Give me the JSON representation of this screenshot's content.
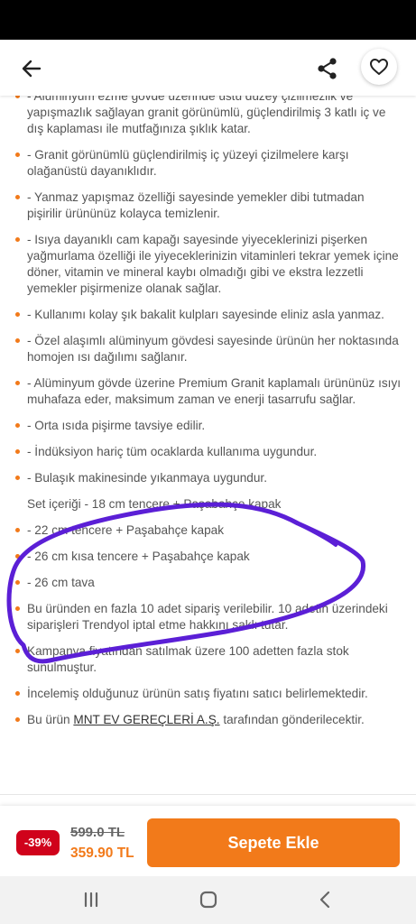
{
  "header": {
    "back_icon": "arrow-left-icon",
    "share_icon": "share-icon",
    "favorite_icon": "heart-outline-icon"
  },
  "description": {
    "items": [
      "- Alüminyum ezme gövde üzerinde üstü düzey çizilmezlik ve yapışmazlık sağlayan granit görünümlü, güçlendirilmiş 3 katlı iç ve dış kaplaması ile mutfağınıza şıklık katar.",
      "- Granit görünümlü güçlendirilmiş iç yüzeyi çizilmelere karşı olağanüstü dayanıklıdır.",
      "- Yanmaz yapışmaz özelliği sayesinde yemekler dibi tutmadan pişirilir ürününüz kolayca temizlenir.",
      "- Isıya dayanıklı cam kapağı sayesinde yiyeceklerinizi pişerken yağmurlama özelliği ile yiyeceklerinizin vitaminleri tekrar yemek içine döner, vitamin ve mineral kaybı olmadığı gibi ve ekstra lezzetli yemekler pişirmenize olanak sağlar.",
      "- Kullanımı kolay şık bakalit kulpları sayesinde eliniz asla yanmaz.",
      "- Özel alaşımlı alüminyum gövdesi sayesinde ürünün her noktasında homojen ısı dağılımı sağlanır.",
      "- Alüminyum gövde üzerine Premium Granit kaplamalı ürününüz ısıyı muhafaza eder, maksimum zaman ve enerji tasarrufu sağlar.",
      "- Orta ısıda pişirme tavsiye edilir.",
      "- İndüksiyon hariç tüm ocaklarda kullanıma uygundur.",
      "- Bulaşık makinesinde yıkanmaya uygundur.",
      "Set içeriği - 18 cm tencere + Paşabahçe kapak",
      "- 22 cm tencere + Paşabahçe kapak",
      "- 26 cm kısa tencere + Paşabahçe kapak",
      "- 26 cm tava"
    ],
    "notes": [
      "Bu üründen en fazla 10 adet sipariş verilebilir. 10 adetin üzerindeki siparişleri Trendyol iptal etme hakkını saklı tutar.",
      "Kampanya fiyatından satılmak üzere 100 adetten fazla stok sunulmuştur.",
      "İncelemiş olduğunuz ürünün satış fiyatını satıcı belirlemektedir."
    ],
    "seller_prefix": "Bu ürün ",
    "seller_name": "MNT EV GEREÇLERİ A.Ş.",
    "seller_suffix": " tarafından gönderilecektir."
  },
  "purchase": {
    "discount": "-39%",
    "old_price": "599.0 TL",
    "new_price": "359.90 TL",
    "add_to_cart": "Sepete Ekle"
  },
  "colors": {
    "accent": "#f27a1a",
    "discount": "#d0021b",
    "annotation": "#5b1fd6"
  },
  "system_nav": [
    "recents-icon",
    "home-icon",
    "back-chevron-icon"
  ]
}
